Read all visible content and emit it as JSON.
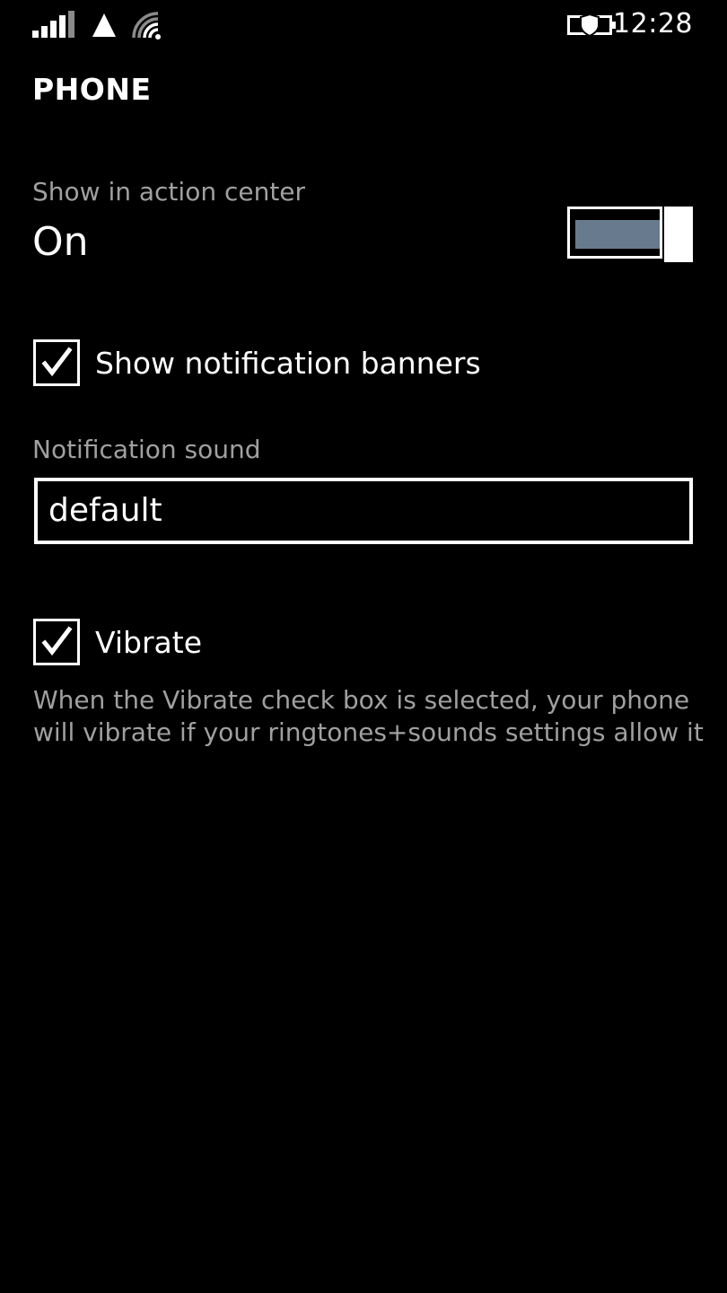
{
  "status_bar": {
    "time": "12:28",
    "icons": [
      "signal-strength-icon",
      "triangle-data-icon",
      "wifi-icon",
      "battery-saver-icon"
    ]
  },
  "page": {
    "title": "PHONE"
  },
  "action_center": {
    "label": "Show in action center",
    "state": "On",
    "enabled": true
  },
  "banners": {
    "label": "Show notification banners",
    "checked": true
  },
  "notification_sound": {
    "label": "Notification sound",
    "value": "default"
  },
  "vibrate": {
    "label": "Vibrate",
    "checked": true,
    "description": "When the Vibrate check box is selected, your phone will vibrate if your ringtones+sounds settings allow it"
  },
  "colors": {
    "background": "#000000",
    "text": "#ffffff",
    "secondary_text": "#a0a0a0",
    "toggle_fill": "#677a8e"
  }
}
